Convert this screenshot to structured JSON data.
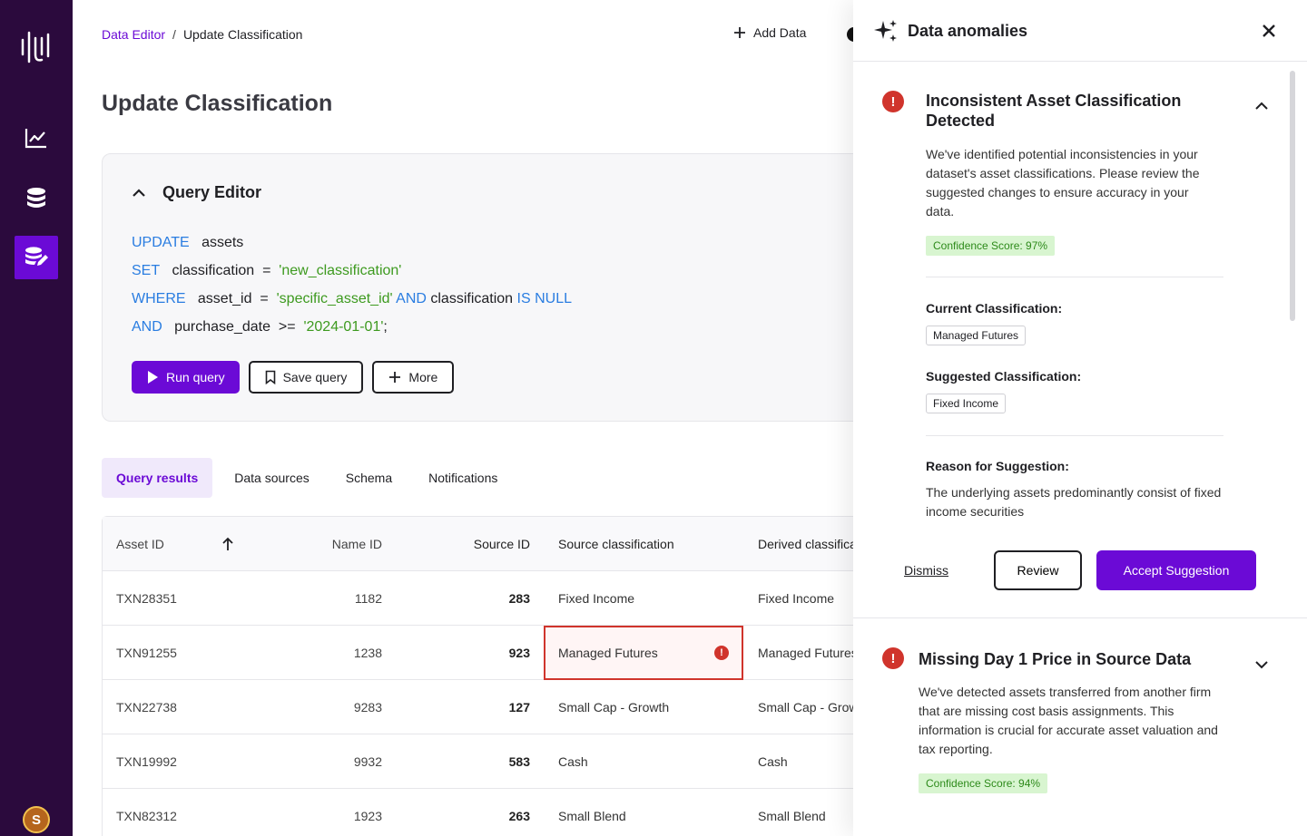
{
  "sidebar": {
    "avatar_initial": "S"
  },
  "header": {
    "breadcrumb_parent": "Data Editor",
    "breadcrumb_sep": "/",
    "breadcrumb_current": "Update Classification",
    "add_data_label": "Add Data"
  },
  "page": {
    "title": "Update Classification"
  },
  "editor": {
    "title": "Query Editor",
    "line1_kw": "UPDATE",
    "line1_rest": "assets",
    "line2_kw": "SET",
    "line2_field": "classification",
    "line2_op": "=",
    "line2_str": "'new_classification'",
    "line3_kw": "WHERE",
    "line3_field": "asset_id",
    "line3_op": "=",
    "line3_str": "'specific_asset_id'",
    "line3_and": "AND",
    "line3_field2": "classification",
    "line3_isnull": "IS NULL",
    "line4_kw": "AND",
    "line4_field": "purchase_date",
    "line4_op": ">=",
    "line4_str": "'2024-01-01'",
    "line4_end": ";",
    "run_label": "Run query",
    "save_label": "Save query",
    "more_label": "More"
  },
  "tabs": [
    {
      "label": "Query results",
      "active": true
    },
    {
      "label": "Data sources"
    },
    {
      "label": "Schema"
    },
    {
      "label": "Notifications"
    }
  ],
  "table": {
    "headers": [
      "Asset ID",
      "Name ID",
      "Source ID",
      "Source classification",
      "Derived classification"
    ],
    "rows": [
      [
        "TXN28351",
        "1182",
        "283",
        "Fixed Income",
        "Fixed Income"
      ],
      [
        "TXN91255",
        "1238",
        "923",
        "Managed Futures",
        "Managed Futures"
      ],
      [
        "TXN22738",
        "9283",
        "127",
        "Small Cap - Growth",
        "Small Cap - Growth"
      ],
      [
        "TXN19992",
        "9932",
        "583",
        "Cash",
        "Cash"
      ],
      [
        "TXN82312",
        "1923",
        "263",
        "Small Blend",
        "Small Blend"
      ]
    ]
  },
  "panel": {
    "title": "Data anomalies",
    "card1": {
      "title": "Inconsistent Asset Classification Detected",
      "body": "We've identified potential inconsistencies in your dataset's asset classifications. Please review the suggested changes to ensure accuracy in your data.",
      "confidence": "Confidence Score: 97%",
      "current_label": "Current Classification:",
      "current_value": "Managed Futures",
      "suggested_label": "Suggested Classification:",
      "suggested_value": "Fixed Income",
      "reason_label": "Reason for Suggestion:",
      "reason_text": "The underlying assets predominantly consist of fixed income securities",
      "dismiss": "Dismiss",
      "review": "Review",
      "accept": "Accept Suggestion"
    },
    "card2": {
      "title": "Missing Day 1 Price in Source Data",
      "body": "We've detected assets transferred from another firm that are missing cost basis assignments. This information is crucial for accurate asset valuation and tax reporting.",
      "confidence": "Confidence Score: 94%"
    }
  },
  "colors": {
    "brand": "#6b0ad6",
    "sidebar": "#2b0a3d",
    "error": "#d0342c",
    "keyword": "#2a7de1",
    "string": "#3d9a1f"
  }
}
